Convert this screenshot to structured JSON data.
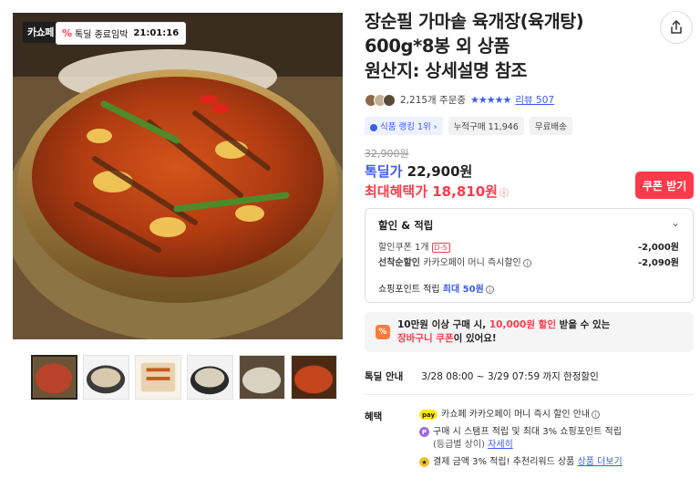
{
  "image_badges": {
    "brand": "카쇼페",
    "timer_icon": "%",
    "timer_text": "톡딜 종료임박",
    "timer_time": "21:01:16"
  },
  "main_image_icon": "stew-bowl-photo",
  "thumbnails": [
    {
      "label": "thumb-1",
      "active": true
    },
    {
      "label": "thumb-2",
      "active": false
    },
    {
      "label": "thumb-3",
      "active": false
    },
    {
      "label": "thumb-4",
      "active": false
    },
    {
      "label": "thumb-5",
      "active": false
    },
    {
      "label": "thumb-6",
      "active": false
    }
  ],
  "product": {
    "title": "장순필 가마솥 육개장(육개탕)\n600g*8봉 외 상품\n원산지: 상세설명 참조",
    "orders": "2,215개 주문중",
    "stars": "★★★★★",
    "review_label": "리뷰 507",
    "chips": {
      "rank": "식품 랭킹 1위 ›",
      "cumulative": "누적구매 11,946",
      "shipping": "무료배송"
    }
  },
  "price": {
    "original": "32,900원",
    "sale_label": "톡딜가",
    "sale_value": "22,900원",
    "max_label": "최대혜택가",
    "max_value": "18,810원",
    "coupon_button": "쿠폰 받기"
  },
  "discount": {
    "header": "할인 & 적립",
    "rows": [
      {
        "label": "할인쿠폰 1개",
        "tag": "D-5",
        "value": "-2,000원"
      },
      {
        "label_bold": "선착순할인",
        "label": "카카오페이 머니 즉시할인",
        "value": "-2,090원"
      }
    ],
    "point_label": "쇼핑포인트 적립",
    "point_max": "최대 50원"
  },
  "promo": {
    "icon": "%",
    "line1_pre": "10만원 이상 구매 시, ",
    "line1_hl": "10,000원 할인",
    "line1_post": " 받을 수 있는",
    "line2_hl": "장바구니 쿠폰",
    "line2_post": "이 있어요!"
  },
  "deal": {
    "label": "톡딜 안내",
    "text": "3/28 08:00 ~ 3/29 07:59 까지 한정할인"
  },
  "benefits": {
    "label": "혜택",
    "pay_icon": "pay",
    "pt_icon": "P",
    "rw_icon": "★",
    "item1": "카쇼페 카카오페이 머니 즉시 할인 안내",
    "item2": "구매 시 스탬프 적립 및 최대 3% 쇼핑포인트 적립",
    "item2_sub": "(등급별 상이)",
    "item2_link": "자세히",
    "item3": "결제 금액 3% 적립! 추천리워드 상품",
    "item3_link": "상품 더보기"
  },
  "colors": {
    "accent_blue": "#3a5cf5",
    "accent_red": "#ff3a4a",
    "promo_orange": "#ff7a3d"
  }
}
